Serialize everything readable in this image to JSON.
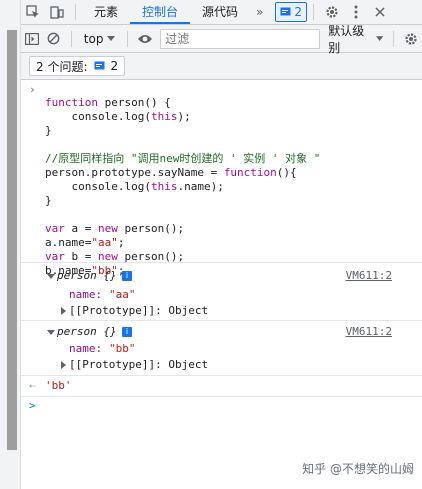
{
  "tabs": {
    "elements": "元素",
    "console": "控制台",
    "sources": "源代码",
    "more": "»",
    "issues_count": "2"
  },
  "toolbar": {
    "context": "top",
    "filter_placeholder": "过滤",
    "levels": "默认级别"
  },
  "issues_bar": {
    "label": "2 个问题:",
    "count": "2"
  },
  "code": {
    "lines": [
      "function person() {",
      "    console.log(this);",
      "}",
      "",
      "//原型同样指向 \"调用new时创建的 ' 实例 ' 对象 \"",
      "person.prototype.sayName = function(){",
      "    console.log(this.name);",
      "}",
      "",
      "var a = new person();",
      "a.name=\"aa\";",
      "var b = new person();",
      "b.name=\"bb\";"
    ]
  },
  "logs": [
    {
      "title": "person {}",
      "source": "VM611:2",
      "name_key": "name:",
      "name_val": "\"aa\"",
      "proto": "[[Prototype]]: Object"
    },
    {
      "title": "person {}",
      "source": "VM611:2",
      "name_key": "name:",
      "name_val": "\"bb\"",
      "proto": "[[Prototype]]: Object"
    }
  ],
  "result": "'bb'",
  "prompt": ">",
  "watermark": "知乎 @不想笑的山姆"
}
